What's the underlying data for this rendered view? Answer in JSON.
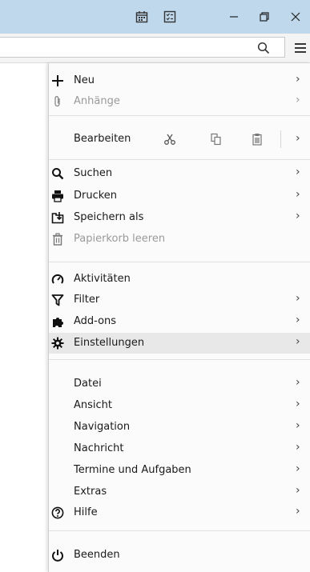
{
  "window": {
    "minimize_glyph": "—",
    "restore_glyph": "❐",
    "close_glyph": "✕"
  },
  "toolbar": {
    "search_icon": "search-icon",
    "menu_icon": "hamburger-icon"
  },
  "menu": {
    "neu": "Neu",
    "anhaenge": "Anhänge",
    "bearbeiten": "Bearbeiten",
    "suchen": "Suchen",
    "drucken": "Drucken",
    "speichern_als": "Speichern als",
    "papierkorb_leeren": "Papierkorb leeren",
    "aktivitaeten": "Aktivitäten",
    "filter": "Filter",
    "add_ons": "Add-ons",
    "einstellungen": "Einstellungen",
    "datei": "Datei",
    "ansicht": "Ansicht",
    "navigation": "Navigation",
    "nachricht": "Nachricht",
    "termine_und_aufgaben": "Termine und Aufgaben",
    "extras": "Extras",
    "hilfe": "Hilfe",
    "beenden": "Beenden",
    "arrow": "›"
  },
  "colors": {
    "titlebar": "#bfd8ec",
    "highlight": "#e8e8e8",
    "disabled_text": "#9a9a9a"
  }
}
